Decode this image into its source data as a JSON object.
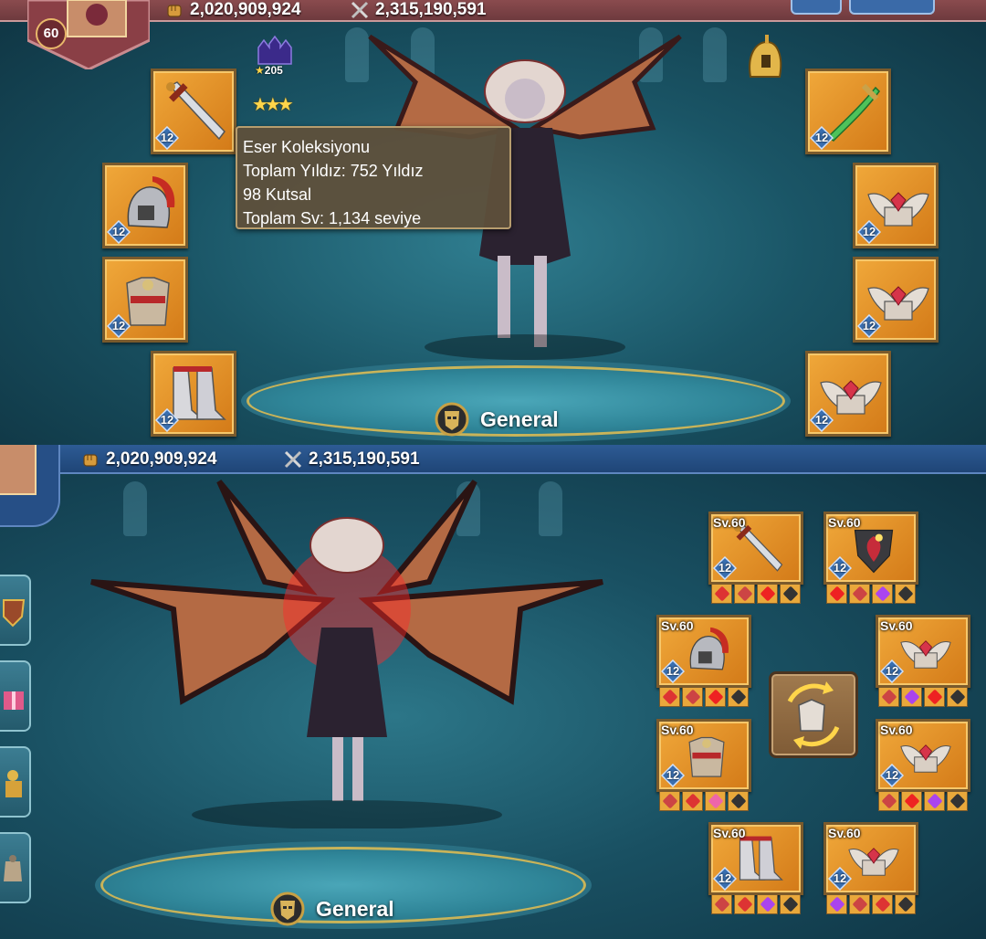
{
  "top": {
    "player_level": "60",
    "power": "2,020,909,924",
    "kills": "2,315,190,591",
    "castle_stars": "205",
    "tooltip": {
      "title": "Eser Koleksiyonu",
      "line1": "Toplam Yıldız: 752 Yıldız",
      "line2": "98 Kutsal",
      "line3": "Toplam Sv: 1,134 seviye"
    },
    "general_label": "General",
    "slots": [
      {
        "level": "12",
        "icon": "sword-icon"
      },
      {
        "level": "12",
        "icon": "helmet-icon"
      },
      {
        "level": "12",
        "icon": "armor-icon"
      },
      {
        "level": "12",
        "icon": "boots-icon"
      },
      {
        "level": "12",
        "icon": "green-sword-icon"
      },
      {
        "level": "12",
        "icon": "winged-relic-icon"
      },
      {
        "level": "12",
        "icon": "winged-relic-icon"
      },
      {
        "level": "12",
        "icon": "winged-relic-icon"
      }
    ]
  },
  "bottom": {
    "power": "2,020,909,924",
    "kills": "2,315,190,591",
    "general_label": "General",
    "slots": [
      {
        "sv": "Sv.60",
        "level": "12",
        "icon": "sword-icon"
      },
      {
        "sv": "Sv.60",
        "level": "12",
        "icon": "shield-icon"
      },
      {
        "sv": "Sv.60",
        "level": "12",
        "icon": "helmet-icon"
      },
      {
        "sv": "Sv.60",
        "level": "12",
        "icon": "winged-relic-icon"
      },
      {
        "sv": "Sv.60",
        "level": "12",
        "icon": "armor-icon"
      },
      {
        "sv": "Sv.60",
        "level": "12",
        "icon": "winged-relic-icon"
      },
      {
        "sv": "Sv.60",
        "level": "12",
        "icon": "boots-icon"
      },
      {
        "sv": "Sv.60",
        "level": "12",
        "icon": "winged-relic-icon"
      }
    ]
  },
  "colors": {
    "slot_orange": "#e6952a",
    "top_bar": "#7a4044",
    "bottom_bar": "#264f86",
    "stage_rim": "#c8b45a",
    "tooltip_bg": "#5f503a"
  }
}
